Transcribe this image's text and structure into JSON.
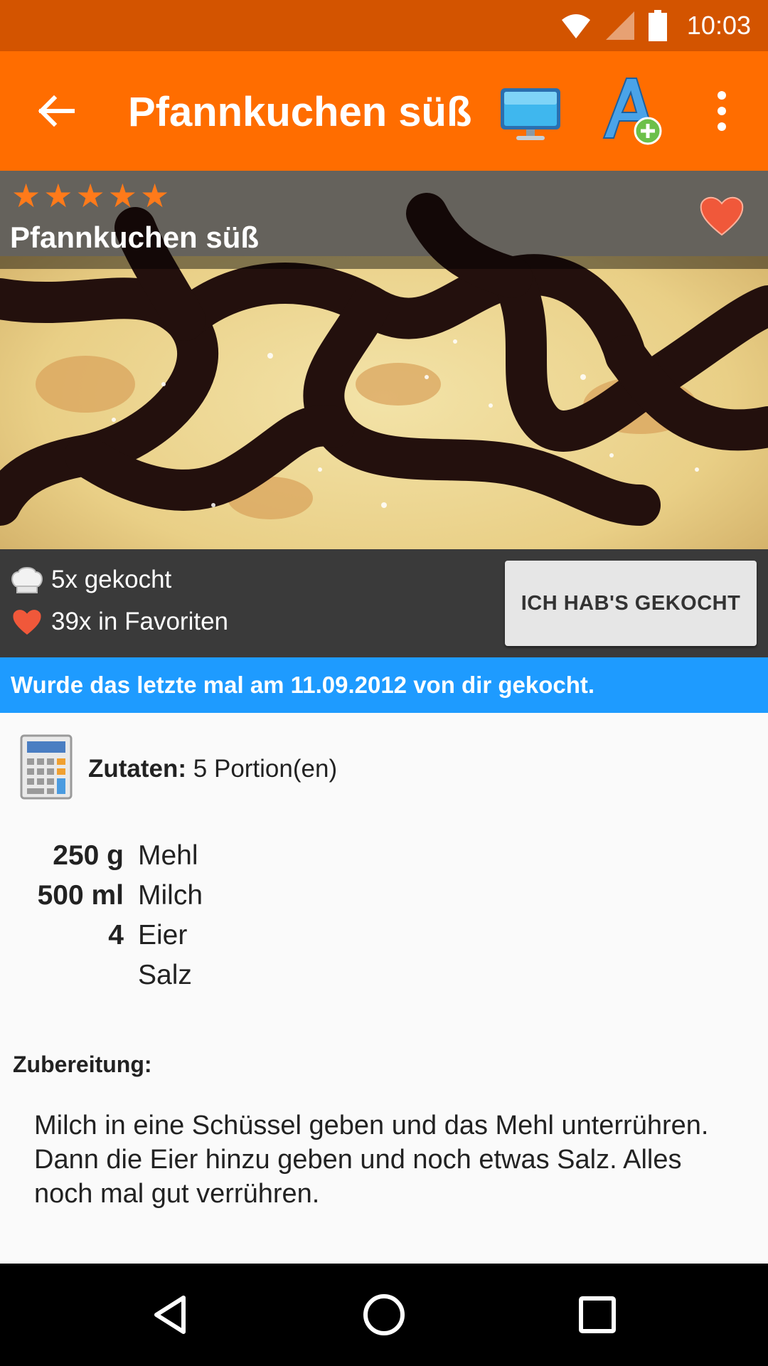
{
  "status_bar": {
    "time": "10:03",
    "icons": [
      "wifi-icon",
      "cell-signal-icon",
      "battery-icon"
    ]
  },
  "app_bar": {
    "title": "Pfannkuchen süß",
    "actions": [
      "back-arrow-icon",
      "tv-icon",
      "font-add-icon",
      "more-vert-icon"
    ],
    "color": "#ff6d00"
  },
  "hero": {
    "rating": 5,
    "rating_max": 5,
    "title": "Pfannkuchen süß",
    "favorite_icon": "heart-icon"
  },
  "stats": {
    "cooked": "5x gekocht",
    "favorites": "39x in Favoriten",
    "button_label": "ICH HAB'S GEKOCHT"
  },
  "banner": {
    "text": "Wurde das letzte mal am 11.09.2012 von dir gekocht.",
    "color": "#1e9bff"
  },
  "ingredients": {
    "label": "Zutaten:",
    "portions": "5 Portion(en)",
    "items": [
      {
        "qty": "250 g",
        "name": "Mehl"
      },
      {
        "qty": "500 ml",
        "name": "Milch"
      },
      {
        "qty": "4",
        "name": "Eier"
      },
      {
        "qty": "",
        "name": "Salz"
      }
    ]
  },
  "preparation": {
    "label": "Zubereitung:",
    "lines": [
      "Milch in eine Schüssel geben und das Mehl unterrühren.",
      "Dann die Eier hinzu geben und noch etwas Salz. Alles noch mal gut verrühren."
    ]
  },
  "nav_bar": {
    "buttons": [
      "back-triangle-icon",
      "home-circle-icon",
      "recents-square-icon"
    ]
  }
}
